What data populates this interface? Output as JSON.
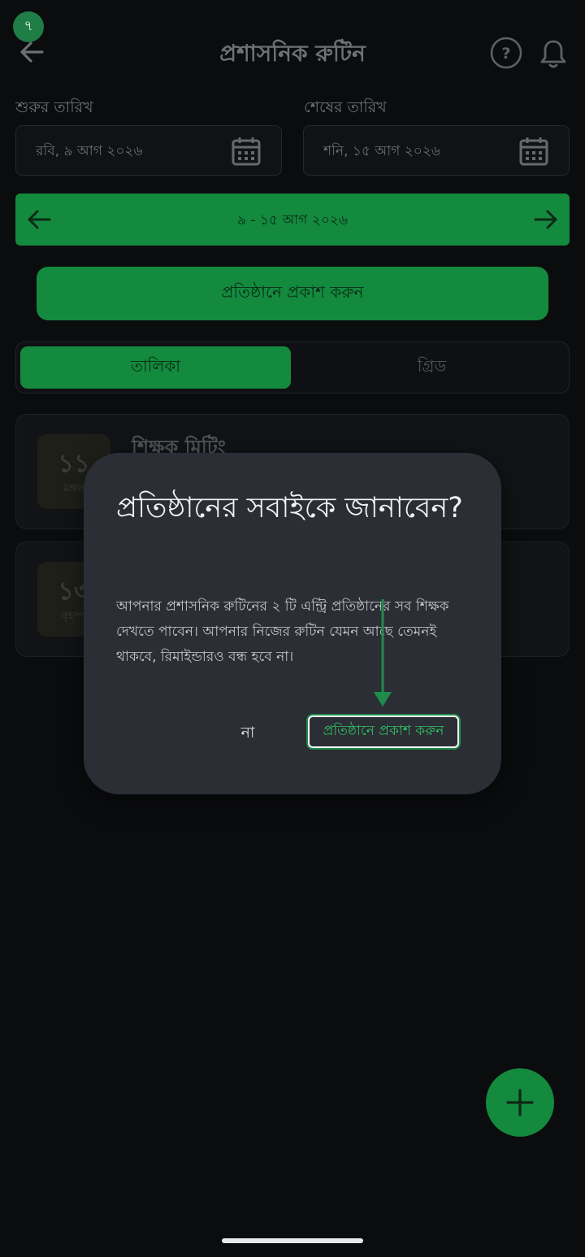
{
  "step_badge": "৭",
  "header": {
    "title": "প্রশাসনিক রুটিন",
    "back_icon": "arrow-left-icon",
    "help_icon": "question-circle-icon",
    "bell_icon": "bell-icon"
  },
  "dates": {
    "start_label": "শুরুর তারিখ",
    "start_value": "রবি, ৯ আগ ২০২৬",
    "end_label": "শেষের তারিখ",
    "end_value": "শনি, ১৫ আগ ২০২৬"
  },
  "week_range": "৯ - ১৫ আগ ২০২৬",
  "publish_button": "প্রতিষ্ঠানে প্রকাশ করুন",
  "view_toggle": {
    "list_label": "তালিকা",
    "grid_label": "গ্রিড",
    "selected": "তালিকা"
  },
  "entries": [
    {
      "day": "১১",
      "weekday": "মঙ্গল",
      "title": "শিক্ষক মিটিং"
    },
    {
      "day": "১৩",
      "weekday": "বৃহস্প",
      "title": ""
    }
  ],
  "dialog": {
    "title": "প্রতিষ্ঠানের সবাইকে জানাবেন?",
    "body": "আপনার প্রশাসনিক রুটিনের ২ টি এন্ট্রি প্রতিষ্ঠানের সব শিক্ষক দেখতে পাবেন। আপনার নিজের রুটিন যেমন আছে তেমনই থাকবে, রিমাইন্ডারও বন্ধ হবে না।",
    "cancel_label": "না",
    "confirm_label": "প্রতিষ্ঠানে প্রকাশ করুন"
  },
  "colors": {
    "accent": "#138a3e",
    "background": "#0b0c0e",
    "dialog": "#2b2e34",
    "confirm_text": "#2fbf62"
  }
}
